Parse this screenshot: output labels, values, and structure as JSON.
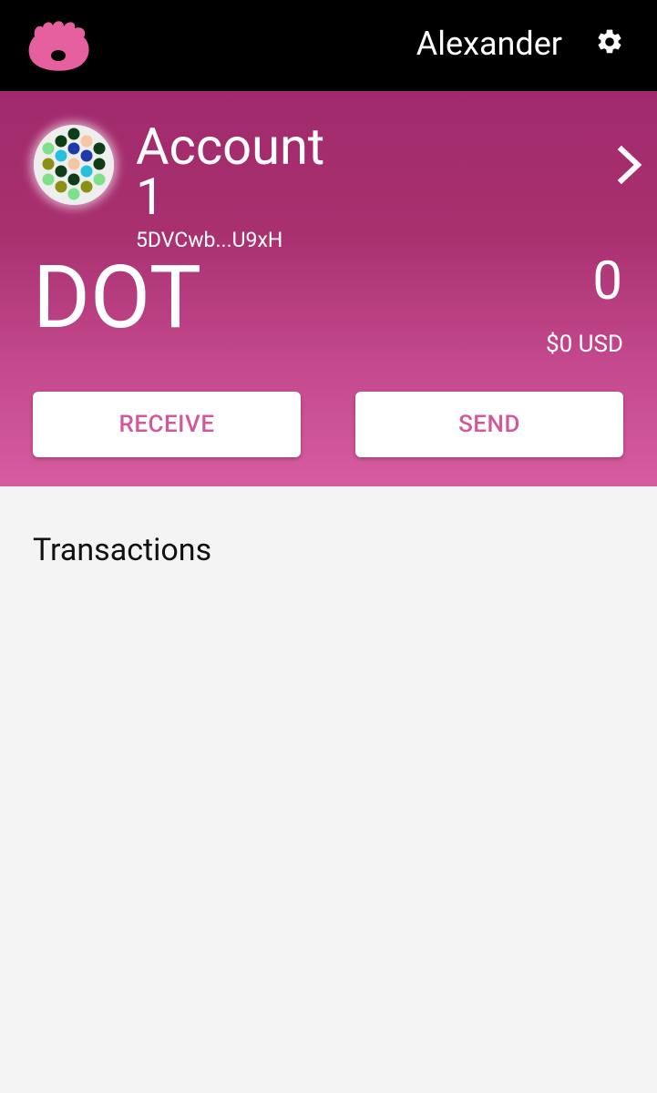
{
  "header": {
    "user_name": "Alexander",
    "logo_icon": "polkadot-logo-icon",
    "settings_icon": "gear-icon",
    "brand_color": "#e6609f"
  },
  "account": {
    "name": "Account 1",
    "address": "5DVCwb...U9xH",
    "avatar_icon": "identicon-avatar",
    "chevron_icon": "chevron-right-icon"
  },
  "balance": {
    "ticker": "DOT",
    "amount": "0",
    "fiat": "$0 USD"
  },
  "actions": {
    "receive_label": "RECEIVE",
    "send_label": "SEND",
    "button_text_color": "#d2589b"
  },
  "transactions": {
    "title": "Transactions",
    "items": []
  },
  "colors": {
    "hero_top": "#a12a6d",
    "hero_bottom": "#d65c9f",
    "page_bg": "#f4f4f4"
  }
}
